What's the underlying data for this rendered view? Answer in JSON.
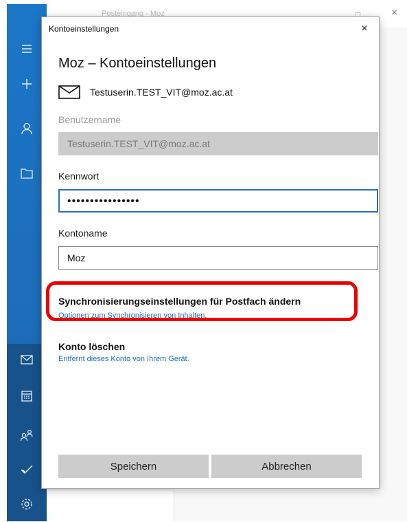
{
  "background_window": {
    "title": "Posteingang - Moz",
    "maximize_glyph": "□",
    "close_glyph": "×"
  },
  "nav_rail": {
    "icons": [
      "menu-icon",
      "plus-icon",
      "person-icon",
      "folder-icon",
      "mail-icon",
      "calendar-icon",
      "people-icon",
      "checkmark-icon",
      "settings-icon"
    ]
  },
  "dialog": {
    "window_title": "Kontoeinstellungen",
    "close_glyph": "×",
    "heading": "Moz – Kontoeinstellungen",
    "email": "Testuserin.TEST_VIT@moz.ac.at",
    "username_label": "Benutzername",
    "username_value": "Testuserin.TEST_VIT@moz.ac.at",
    "password_label": "Kennwort",
    "password_value": "••••••••••••••••",
    "account_name_label": "Kontoname",
    "account_name_value": "Moz",
    "sync_title": "Synchronisierungseinstellungen für Postfach ändern",
    "sync_link": "Optionen zum Synchronisieren von Inhalten.",
    "delete_title": "Konto löschen",
    "delete_link": "Entfernt dieses Konto von Ihrem Gerät.",
    "save_label": "Speichern",
    "cancel_label": "Abbrechen",
    "highlight_color": "#ee0000"
  }
}
